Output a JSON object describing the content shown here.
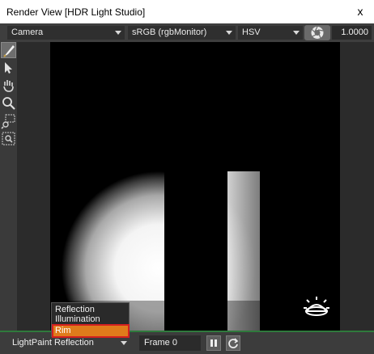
{
  "window": {
    "title": "Render View [HDR Light Studio]",
    "close_glyph": "x"
  },
  "toolbar": {
    "camera": "Camera",
    "colorspace": "sRGB (rgbMonitor)",
    "colormode": "HSV",
    "exposure_icon": "aperture-icon",
    "exposure_value": "1.0000"
  },
  "tools": [
    {
      "name": "paint-brush-icon",
      "active": true
    },
    {
      "name": "select-arrow-icon",
      "active": false
    },
    {
      "name": "pan-hand-icon",
      "active": false
    },
    {
      "name": "zoom-icon",
      "active": false
    },
    {
      "name": "zoom-region-icon",
      "active": false
    },
    {
      "name": "fit-view-icon",
      "active": false
    }
  ],
  "viewport": {
    "overlay_icon": "light-source-icon"
  },
  "bottom": {
    "mode": "LightPaint Reflection",
    "frame": "Frame 0",
    "pause_icon": "pause-icon",
    "refresh_icon": "refresh-icon"
  },
  "dropdown": {
    "items": [
      "Reflection",
      "Illumination",
      "Rim"
    ],
    "selected": "Rim"
  },
  "colors": {
    "accent_green": "#2f7a3c",
    "highlight_orange": "#e07b1b",
    "highlight_outline": "#d42020"
  }
}
